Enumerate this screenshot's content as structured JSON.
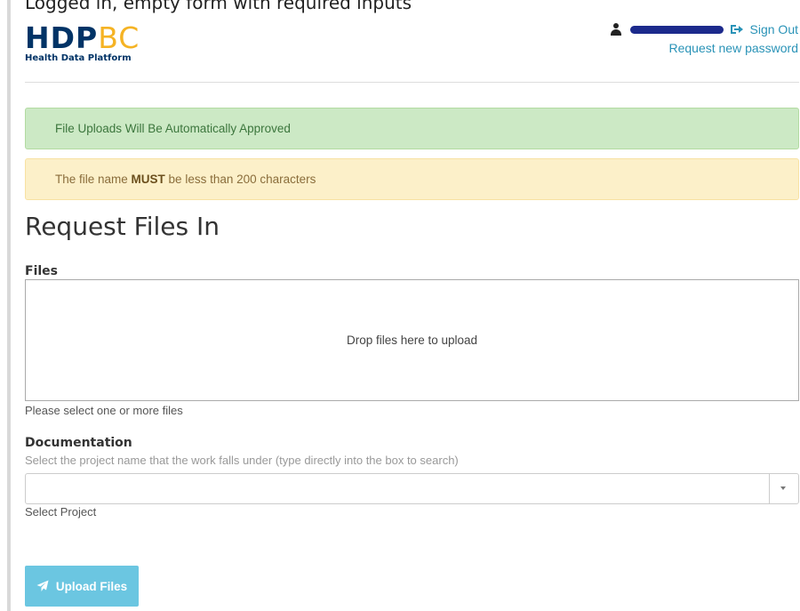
{
  "top_caption": "Logged in, empty form with required inputs",
  "logo": {
    "mark_primary": "HDP",
    "mark_secondary": "BC",
    "subtitle": "Health Data Platform"
  },
  "user": {
    "sign_out_label": "Sign Out",
    "request_password_label": "Request new password"
  },
  "alerts": {
    "success_text": "File Uploads Will Be Automatically Approved",
    "warning_prefix": "The file name ",
    "warning_emphasis": "MUST",
    "warning_suffix": " be less than 200 characters"
  },
  "page_title": "Request Files In",
  "files": {
    "label": "Files",
    "dropzone_text": "Drop files here to upload",
    "help_text": "Please select one or more files"
  },
  "documentation": {
    "label": "Documentation",
    "description": "Select the project name that the work falls under (type directly into the box to search)",
    "select_value": "",
    "help_text": "Select Project"
  },
  "upload_button_label": "Upload Files",
  "colors": {
    "brand_navy": "#003366",
    "brand_gold": "#f5b324",
    "link": "#2a93b7",
    "success_bg": "#cce9c5",
    "warning_bg": "#fcf0c9",
    "button": "#5bc0de"
  },
  "icons": [
    "user-icon",
    "sign-out-icon",
    "dropdown-caret-icon",
    "paper-plane-icon"
  ]
}
